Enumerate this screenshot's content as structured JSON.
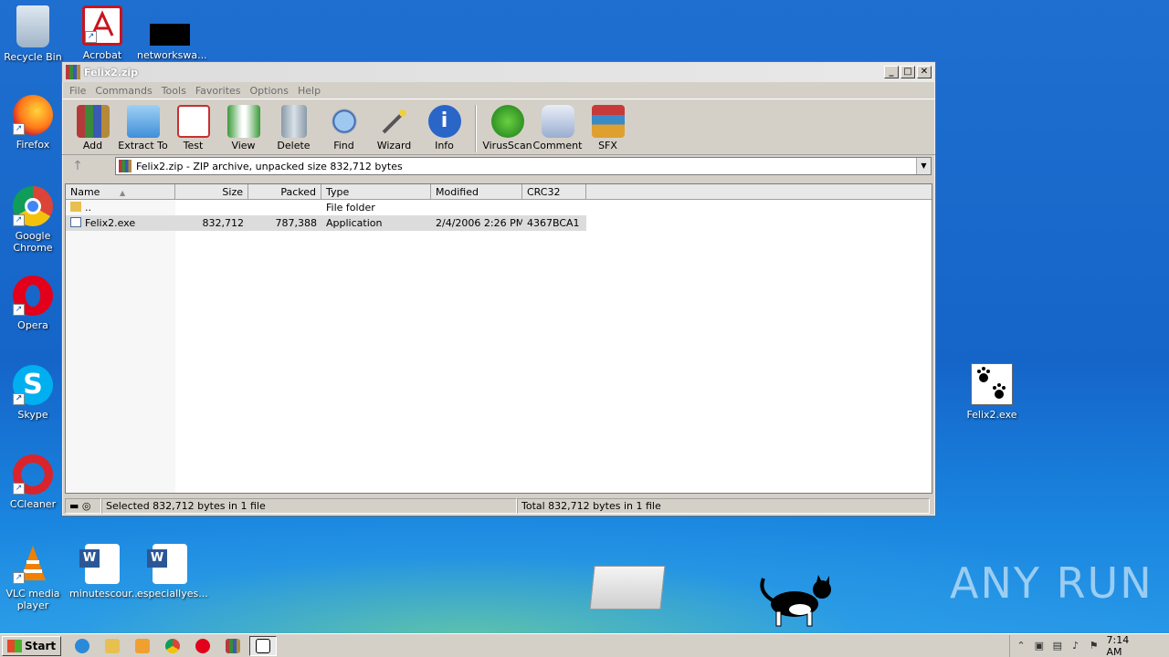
{
  "desktop": {
    "icons": [
      {
        "label": "Recycle Bin"
      },
      {
        "label": "Acrobat"
      },
      {
        "label": "networkswa..."
      },
      {
        "label": "Firefox"
      },
      {
        "label": "Google Chrome"
      },
      {
        "label": "Opera"
      },
      {
        "label": "Skype"
      },
      {
        "label": "CCleaner"
      },
      {
        "label": "VLC media player"
      },
      {
        "label": "minutescour..."
      },
      {
        "label": "especiallyes..."
      },
      {
        "label": "Felix2.exe"
      }
    ],
    "watermark": "ANY RUN"
  },
  "window": {
    "title": "Felix2.zip",
    "menu": [
      "File",
      "Commands",
      "Tools",
      "Favorites",
      "Options",
      "Help"
    ],
    "toolbar": [
      "Add",
      "Extract To",
      "Test",
      "View",
      "Delete",
      "Find",
      "Wizard",
      "Info",
      "VirusScan",
      "Comment",
      "SFX"
    ],
    "address": "Felix2.zip - ZIP archive, unpacked size 832,712 bytes",
    "columns": [
      "Name",
      "Size",
      "Packed",
      "Type",
      "Modified",
      "CRC32"
    ],
    "rows": [
      {
        "name": "..",
        "size": "",
        "packed": "",
        "type": "File folder",
        "modified": "",
        "crc": ""
      },
      {
        "name": "Felix2.exe",
        "size": "832,712",
        "packed": "787,388",
        "type": "Application",
        "modified": "2/4/2006 2:26 PM",
        "crc": "4367BCA1"
      }
    ],
    "status_left": "Selected 832,712 bytes in 1 file",
    "status_right": "Total 832,712 bytes in 1 file"
  },
  "taskbar": {
    "start_label": "Start",
    "clock": "7:14 AM"
  }
}
